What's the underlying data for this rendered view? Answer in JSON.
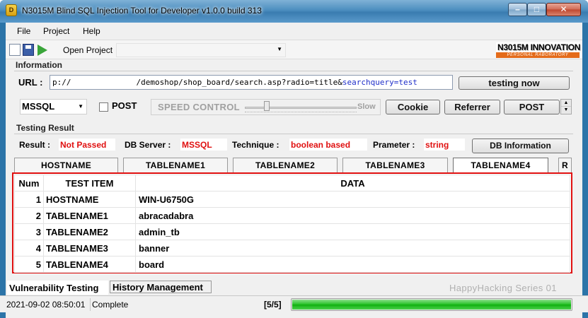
{
  "window": {
    "title": "N3015M Blind SQL Injection Tool for Developer v1.0.0 build 313",
    "app_icon_text": "D"
  },
  "menu": [
    "File",
    "Project",
    "Help"
  ],
  "toolbar": {
    "open_project_label": "Open Project",
    "project_value": "",
    "brand_name": "N3015M INNOVATION",
    "brand_sub": "PERSONAL RABORATORY"
  },
  "information": {
    "title": "Information",
    "url_label": "URL :",
    "url_prefix": "p://",
    "url_path": "/demoshop/shop_board/search.asp?radio=title&",
    "url_query": "searchquery=test",
    "testing_button": "testing now",
    "db_type": "MSSQL",
    "post_checkbox_label": "POST",
    "post_checked": false,
    "speed_control_label": "SPEED CONTROL",
    "speed_level_fraction": 0.18,
    "slow_label": "Slow",
    "cookie_button": "Cookie",
    "referrer_button": "Referrer",
    "post_button": "POST"
  },
  "result": {
    "title": "Testing Result",
    "result_label": "Result :",
    "result_value": "Not Passed",
    "db_server_label": "DB Server :",
    "db_server_value": "MSSQL",
    "technique_label": "Technique :",
    "technique_value": "boolean based",
    "parameter_label": "Prameter :",
    "parameter_value": "string",
    "db_info_button": "DB Information",
    "tabs": [
      "HOSTNAME",
      "TABLENAME1",
      "TABLENAME2",
      "TABLENAME3",
      "TABLENAME4",
      "R"
    ],
    "active_tab": "TABLENAME4"
  },
  "grid": {
    "headers": [
      "Num",
      "TEST ITEM",
      "DATA"
    ],
    "rows": [
      {
        "num": "1",
        "item": "HOSTNAME",
        "data": "WIN-U6750G"
      },
      {
        "num": "2",
        "item": "TABLENAME1",
        "data": "abracadabra"
      },
      {
        "num": "3",
        "item": "TABLENAME2",
        "data": "admin_tb"
      },
      {
        "num": "4",
        "item": "TABLENAME3",
        "data": "banner"
      },
      {
        "num": "5",
        "item": "TABLENAME4",
        "data": "board"
      }
    ]
  },
  "bottom_tabs": {
    "vulnerability": "Vulnerability Testing",
    "history": "History Management",
    "series": "HappyHacking Series 01"
  },
  "statusbar": {
    "datetime": "2021-09-02 08:50:01",
    "status": "Complete",
    "count": "[5/5]",
    "progress_fraction": 1.0
  },
  "colors": {
    "highlight_red": "#e01010",
    "query_blue": "#1f2ec9",
    "progress_green": "#22c022",
    "brand_orange": "#e46b1a"
  }
}
